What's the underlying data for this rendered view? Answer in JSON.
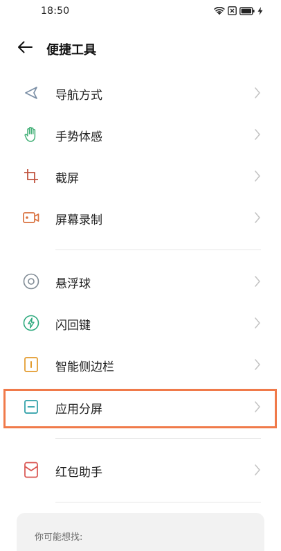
{
  "status_bar": {
    "time": "18:50",
    "icons": [
      "wifi-icon",
      "close-box-icon",
      "battery-icon",
      "charging-icon"
    ]
  },
  "header": {
    "back_icon": "arrow-left-icon",
    "title": "便捷工具"
  },
  "menu_items": [
    {
      "label": "导航方式",
      "icon": "navigation-icon",
      "color": "#7b8fa6"
    },
    {
      "label": "手势体感",
      "icon": "hand-icon",
      "color": "#3fae74"
    },
    {
      "label": "截屏",
      "icon": "crop-icon",
      "color": "#c0533f"
    },
    {
      "label": "屏幕录制",
      "icon": "video-record-icon",
      "color": "#d9713e"
    },
    {
      "label": "悬浮球",
      "icon": "floating-ball-icon",
      "color": "#7f8a94"
    },
    {
      "label": "闪回键",
      "icon": "flash-icon",
      "color": "#2eaa7e"
    },
    {
      "label": "智能侧边栏",
      "icon": "sidebar-icon",
      "color": "#e29a2b"
    },
    {
      "label": "应用分屏",
      "icon": "split-screen-icon",
      "color": "#2a9ea6"
    },
    {
      "label": "红包助手",
      "icon": "envelope-icon",
      "color": "#d9534f"
    }
  ],
  "highlight": {
    "color": "#f07a4a",
    "target": "应用分屏"
  },
  "suggestions": {
    "title": "你可能想找:"
  }
}
